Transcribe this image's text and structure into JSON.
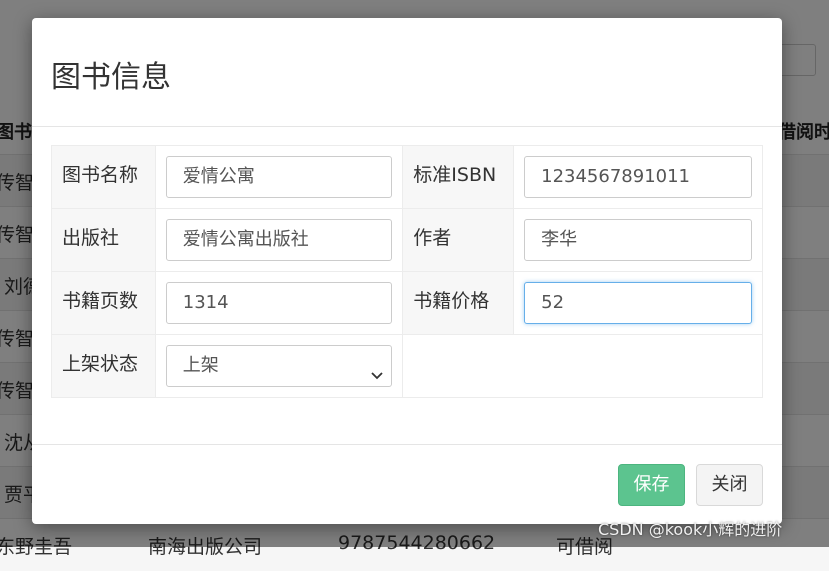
{
  "background": {
    "header_left": "图书",
    "header_right": "借阅时",
    "rows": [
      {
        "c1": "传智"
      },
      {
        "c1": "传智"
      },
      {
        "c1": "刘德"
      },
      {
        "c1": "传智"
      },
      {
        "c1": "传智"
      },
      {
        "c1": "沈从"
      },
      {
        "c1": "贾平"
      },
      {
        "c1": "东野圭吾",
        "c2": "南海出版公司",
        "c3": "9787544280662",
        "c4": "可借阅"
      }
    ]
  },
  "modal": {
    "title": "图书信息",
    "fields": {
      "name": {
        "label": "图书名称",
        "value": "爱情公寓"
      },
      "isbn": {
        "label": "标准ISBN",
        "value": "1234567891011"
      },
      "press": {
        "label": "出版社",
        "value": "爱情公寓出版社"
      },
      "author": {
        "label": "作者",
        "value": "李华"
      },
      "pages": {
        "label": "书籍页数",
        "value": "1314"
      },
      "price": {
        "label": "书籍价格",
        "value": "52"
      },
      "status": {
        "label": "上架状态",
        "value": "上架"
      }
    },
    "buttons": {
      "save": "保存",
      "close": "关闭"
    },
    "colors": {
      "save": "#5cc48f",
      "focus_border": "#66afe9"
    }
  },
  "watermark": "CSDN @kook小辉的进阶"
}
